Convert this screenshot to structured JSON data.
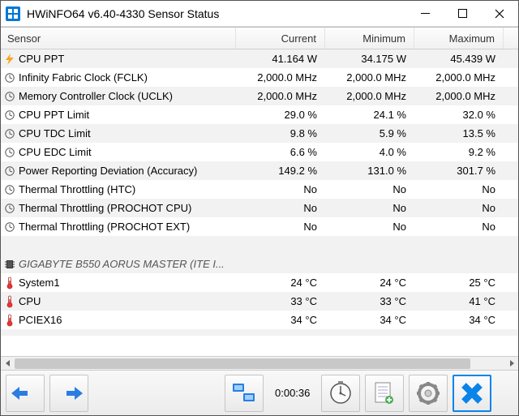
{
  "window": {
    "title": "HWiNFO64 v6.40-4330 Sensor Status",
    "app_icon_label": "HW"
  },
  "columns": {
    "sensor": "Sensor",
    "current": "Current",
    "minimum": "Minimum",
    "maximum": "Maximum"
  },
  "rows": [
    {
      "icon": "bolt",
      "name": "CPU PPT",
      "cur": "41.164 W",
      "min": "34.175 W",
      "max": "45.439 W",
      "hl": true
    },
    {
      "icon": "clock",
      "name": "Infinity Fabric Clock (FCLK)",
      "cur": "2,000.0 MHz",
      "min": "2,000.0 MHz",
      "max": "2,000.0 MHz"
    },
    {
      "icon": "clock",
      "name": "Memory Controller Clock (UCLK)",
      "cur": "2,000.0 MHz",
      "min": "2,000.0 MHz",
      "max": "2,000.0 MHz",
      "hl": true
    },
    {
      "icon": "clock",
      "name": "CPU PPT Limit",
      "cur": "29.0 %",
      "min": "24.1 %",
      "max": "32.0 %"
    },
    {
      "icon": "clock",
      "name": "CPU TDC Limit",
      "cur": "9.8 %",
      "min": "5.9 %",
      "max": "13.5 %",
      "hl": true
    },
    {
      "icon": "clock",
      "name": "CPU EDC Limit",
      "cur": "6.6 %",
      "min": "4.0 %",
      "max": "9.2 %"
    },
    {
      "icon": "clock",
      "name": "Power Reporting Deviation (Accuracy)",
      "cur": "149.2 %",
      "min": "131.0 %",
      "max": "301.7 %",
      "hl": true
    },
    {
      "icon": "clock",
      "name": "Thermal Throttling (HTC)",
      "cur": "No",
      "min": "No",
      "max": "No"
    },
    {
      "icon": "clock",
      "name": "Thermal Throttling (PROCHOT CPU)",
      "cur": "No",
      "min": "No",
      "max": "No",
      "hl": true
    },
    {
      "icon": "clock",
      "name": "Thermal Throttling (PROCHOT EXT)",
      "cur": "No",
      "min": "No",
      "max": "No"
    }
  ],
  "section": {
    "name": "GIGABYTE B550 AORUS MASTER (ITE I..."
  },
  "rows2": [
    {
      "icon": "therm",
      "name": "System1",
      "cur": "24 °C",
      "min": "24 °C",
      "max": "25 °C"
    },
    {
      "icon": "therm",
      "name": "CPU",
      "cur": "33 °C",
      "min": "33 °C",
      "max": "41 °C",
      "hl": true
    },
    {
      "icon": "therm",
      "name": "PCIEX16",
      "cur": "34 °C",
      "min": "34 °C",
      "max": "34 °C"
    }
  ],
  "toolbar": {
    "timer": "0:00:36"
  }
}
